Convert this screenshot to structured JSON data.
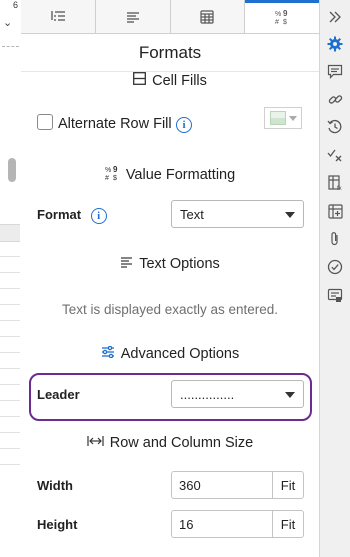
{
  "left_strip": {
    "column_number": "6"
  },
  "tabs": [
    {
      "name": "tab-outline",
      "icon": "outline-list-icon"
    },
    {
      "name": "tab-text",
      "icon": "text-lines-icon"
    },
    {
      "name": "tab-table",
      "icon": "table-grid-icon"
    },
    {
      "name": "tab-formats",
      "icon": "value-format-icon",
      "active": true
    }
  ],
  "panel": {
    "title": "Formats",
    "cell_fills": {
      "heading": "Cell Fills",
      "alternate_row_fill_label": "Alternate Row Fill"
    },
    "value_formatting": {
      "heading": "Value Formatting",
      "format_label": "Format",
      "format_value": "Text"
    },
    "text_options": {
      "heading": "Text Options",
      "note": "Text is displayed exactly as entered."
    },
    "advanced_options": {
      "heading": "Advanced Options",
      "leader_label": "Leader",
      "leader_value": "..............."
    },
    "row_column_size": {
      "heading": "Row and Column Size",
      "width_label": "Width",
      "width_value": "360",
      "height_label": "Height",
      "height_value": "16",
      "fit_label": "Fit"
    }
  },
  "right_toolbar": [
    "chevron-double-right-icon",
    "gear-icon",
    "comment-icon",
    "link-icon",
    "history-icon",
    "check-x-icon",
    "document-table-icon",
    "table-add-icon",
    "paperclip-icon",
    "checkmark-circle-icon",
    "comment-list-icon"
  ],
  "colors": {
    "accent": "#1f6fd0",
    "highlight": "#6a2c91",
    "note_text": "#6f6f6f"
  }
}
